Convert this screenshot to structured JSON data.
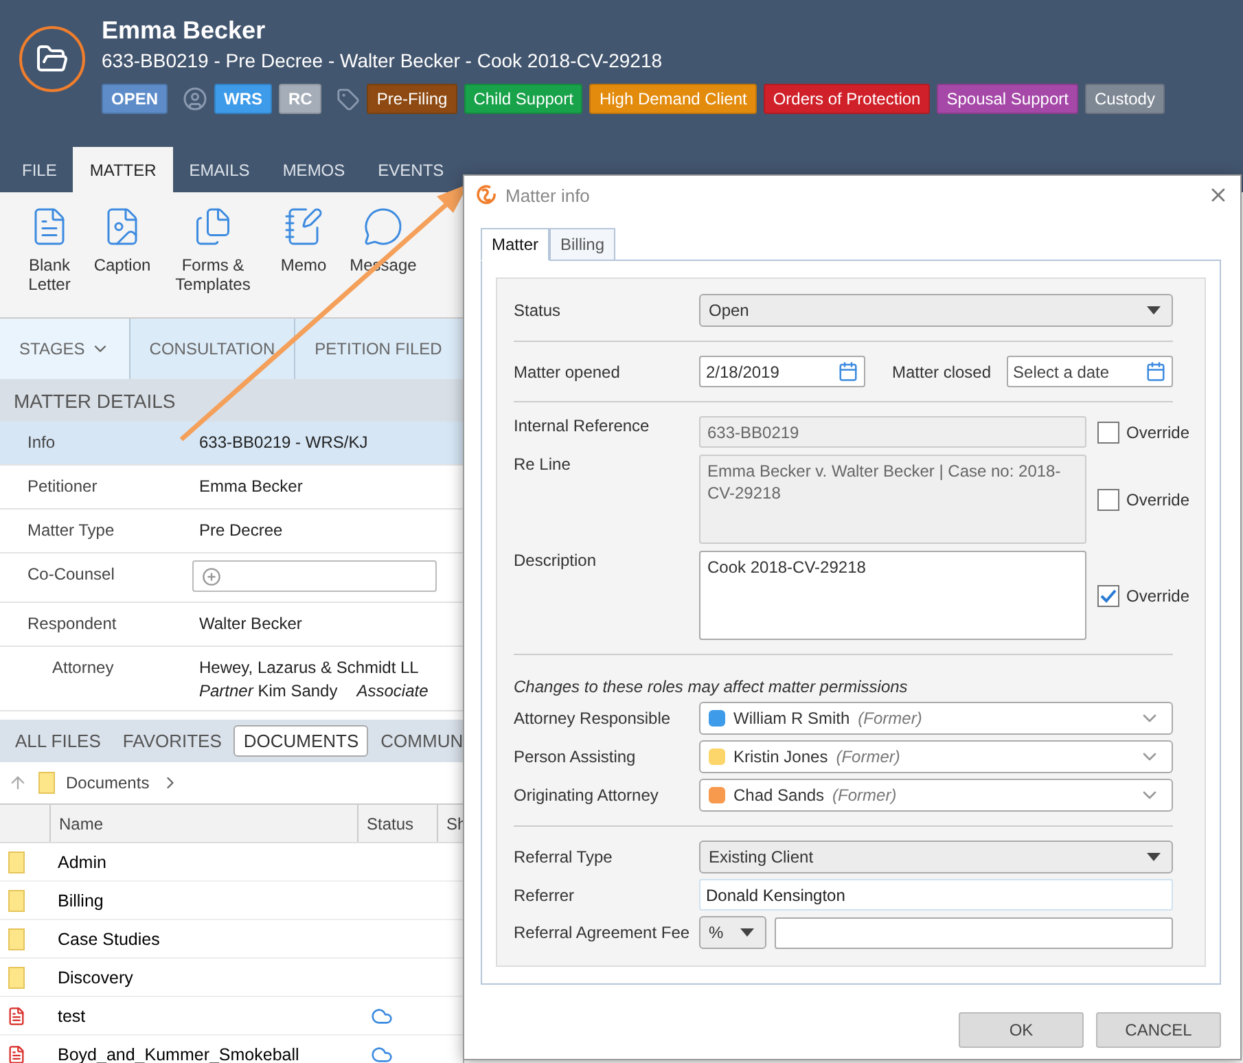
{
  "header": {
    "name": "Emma Becker",
    "subtitle": "633-BB0219 - Pre Decree - Walter Becker - Cook 2018-CV-29218",
    "status": "OPEN",
    "staff": [
      {
        "label": "WRS",
        "color": "#3d9be9"
      },
      {
        "label": "RC",
        "color": "#a4adb8"
      }
    ],
    "tags": [
      {
        "label": "Pre-Filing",
        "color": "#8e4a12"
      },
      {
        "label": "Child Support",
        "color": "#18a24a"
      },
      {
        "label": "High Demand Client",
        "color": "#e38b0c"
      },
      {
        "label": "Orders of Protection",
        "color": "#d0202a"
      },
      {
        "label": "Spousal Support",
        "color": "#a548a8"
      },
      {
        "label": "Custody",
        "color": "#7e8894"
      }
    ]
  },
  "menu_tabs": [
    {
      "label": "FILE",
      "selected": false
    },
    {
      "label": "MATTER",
      "selected": true
    },
    {
      "label": "EMAILS",
      "selected": false
    },
    {
      "label": "MEMOS",
      "selected": false
    },
    {
      "label": "EVENTS",
      "selected": false
    }
  ],
  "ribbon": [
    {
      "label": "Blank Letter",
      "kind": "letter"
    },
    {
      "label": "Caption",
      "kind": "caption"
    },
    {
      "label": "Forms & Templates",
      "kind": "forms"
    },
    {
      "label": "Memo",
      "kind": "memo"
    },
    {
      "label": "Message",
      "kind": "message"
    }
  ],
  "stages": {
    "label": "STAGES",
    "items": [
      "CONSULTATION",
      "PETITION FILED"
    ]
  },
  "matter_details": {
    "title": "MATTER DETAILS",
    "rows": [
      {
        "label": "Info",
        "value": "633-BB0219 - WRS/KJ",
        "kind": "text",
        "selected": true
      },
      {
        "label": "Petitioner",
        "value": "Emma Becker",
        "kind": "text",
        "selected": false
      },
      {
        "label": "Matter Type",
        "value": "Pre Decree",
        "kind": "text",
        "selected": false
      },
      {
        "label": "Co-Counsel",
        "kind": "field",
        "selected": false
      },
      {
        "label": "Respondent",
        "value": "Walter Becker",
        "kind": "text",
        "selected": false,
        "children": [
          {
            "label": "Attorney",
            "value": "Hewey, Lazarus & Schmidt LL",
            "kind": "attorney",
            "selected": false,
            "roles": [
              {
                "role": "Partner",
                "name": "Kim Sandy"
              },
              {
                "role": "Associate"
              }
            ]
          }
        ]
      }
    ]
  },
  "file_tabs": [
    {
      "label": "ALL FILES",
      "selected": false
    },
    {
      "label": "FAVORITES",
      "selected": false
    },
    {
      "label": "DOCUMENTS",
      "selected": true
    },
    {
      "label": "COMMUN",
      "selected": false
    }
  ],
  "breadcrumb": "Documents",
  "files": {
    "columns": [
      "Name",
      "Status",
      "Sh"
    ],
    "rows": [
      {
        "name": "Admin",
        "kind": "folder",
        "cloud": false
      },
      {
        "name": "Billing",
        "kind": "folder",
        "cloud": false
      },
      {
        "name": "Case Studies",
        "kind": "folder",
        "cloud": false
      },
      {
        "name": "Discovery",
        "kind": "folder",
        "cloud": false
      },
      {
        "name": "test",
        "kind": "pdf",
        "cloud": true
      },
      {
        "name": "Boyd_and_Kummer_Smokeball",
        "kind": "pdf",
        "cloud": true
      }
    ]
  },
  "dialog": {
    "title": "Matter info",
    "tabs": [
      {
        "label": "Matter",
        "selected": true
      },
      {
        "label": "Billing",
        "selected": false
      }
    ],
    "status": {
      "label": "Status",
      "value": "Open"
    },
    "matter_opened": {
      "label": "Matter opened",
      "value": "2/18/2019"
    },
    "matter_closed": {
      "label": "Matter closed",
      "placeholder": "Select a date"
    },
    "internal_reference": {
      "label": "Internal Reference",
      "value": "633-BB0219",
      "override_label": "Override",
      "override": false
    },
    "re_line": {
      "label": "Re Line",
      "value": "Emma Becker v. Walter Becker | Case no: 2018-CV-29218",
      "override_label": "Override",
      "override": false
    },
    "description": {
      "label": "Description",
      "value": "Cook 2018-CV-29218",
      "override_label": "Override",
      "override": true
    },
    "roles_note": "Changes to these roles may affect matter permissions",
    "roles": [
      {
        "label": "Attorney Responsible",
        "name": "William R Smith",
        "note": "(Former)",
        "color": "#3d9be9"
      },
      {
        "label": "Person Assisting",
        "name": "Kristin Jones",
        "note": "(Former)",
        "color": "#fcd66a"
      },
      {
        "label": "Originating Attorney",
        "name": "Chad Sands",
        "note": "(Former)",
        "color": "#f79a4e"
      }
    ],
    "referral_type": {
      "label": "Referral Type",
      "value": "Existing Client"
    },
    "referrer": {
      "label": "Referrer",
      "value": "Donald Kensington"
    },
    "referral_fee": {
      "label": "Referral Agreement Fee",
      "unit": "%"
    },
    "buttons": [
      "OK",
      "CANCEL"
    ]
  }
}
